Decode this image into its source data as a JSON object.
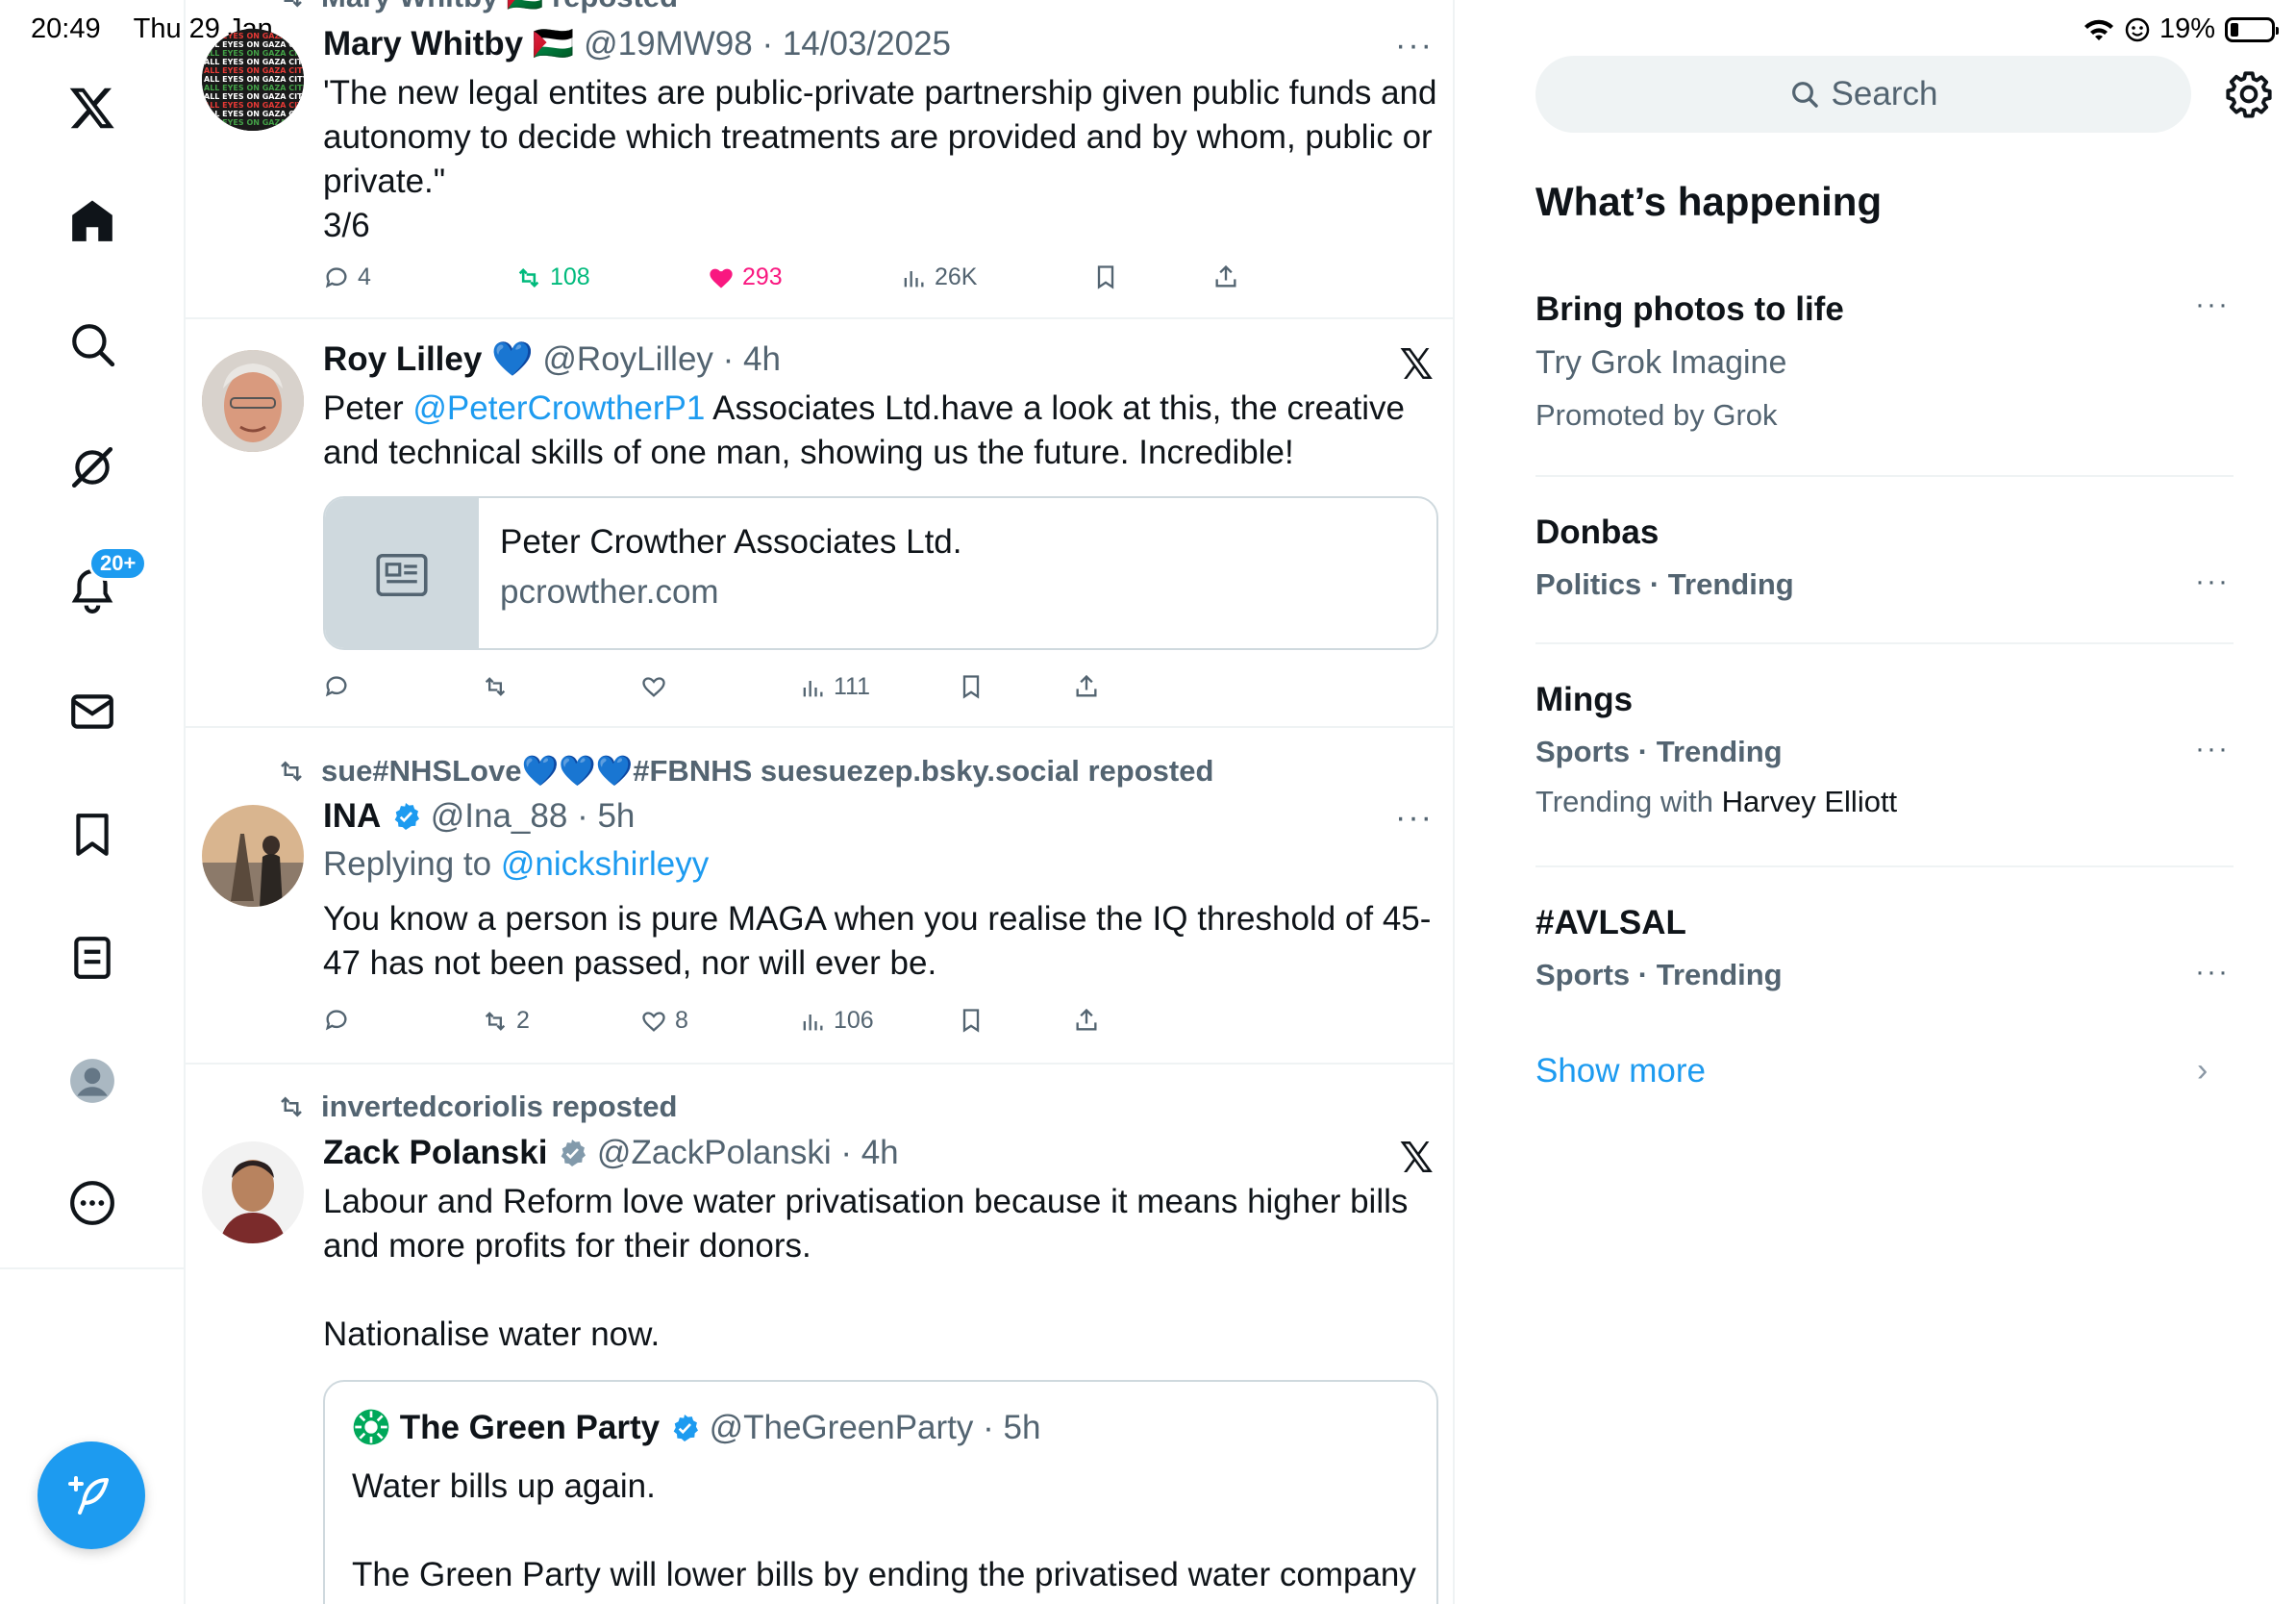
{
  "status_bar": {
    "time": "20:49",
    "date": "Thu 29 Jan",
    "battery": "19%",
    "battery_level": 0.19
  },
  "left_nav": {
    "items": [
      {
        "name": "x-logo"
      },
      {
        "name": "home"
      },
      {
        "name": "explore"
      },
      {
        "name": "grok"
      },
      {
        "name": "notifications",
        "badge": "20+"
      },
      {
        "name": "messages"
      },
      {
        "name": "bookmarks"
      },
      {
        "name": "lists"
      },
      {
        "name": "profile"
      },
      {
        "name": "more"
      }
    ],
    "compose_icon": "feather-plus-icon"
  },
  "feed": {
    "tweets": [
      {
        "repost_header": "Mary Whitby 🇵🇸 reposted",
        "name": "Mary Whitby",
        "flag": "🇵🇸",
        "handle": "@19MW98",
        "time": "14/03/2025",
        "text": "'The new legal entites are public-private partnership given public funds and autonomy to decide which treatments are provided and by whom, public or private.\"",
        "text2": "3/6",
        "replies": "4",
        "reposts": "108",
        "likes": "293",
        "views": "26K",
        "reposted": true,
        "liked": true,
        "avatar_text": "ALL EYES ON GAZA CITY"
      },
      {
        "name": "Roy Lilley",
        "badge_emoji": "💙",
        "handle": "@RoyLilley",
        "time": "4h",
        "text_pre": "Peter ",
        "mention": "@PeterCrowtherP1",
        "text_post": " Associates Ltd.have a look at this, the creative and technical skills of one man, showing us the future.  Incredible!",
        "card": {
          "title": "Peter Crowther Associates Ltd.",
          "domain": "pcrowther.com"
        },
        "views": "111"
      },
      {
        "repost_header": "sue#NHSLove💙💙💙#FBNHS suesuezep.bsky.social reposted",
        "name": "INA",
        "handle": "@Ina_88",
        "time": "5h",
        "replying_label": "Replying to ",
        "replying_to": "@nickshirleyy",
        "text": "You know a person is pure MAGA when you realise the IQ threshold of 45-47 has not been passed, nor will ever be.",
        "reposts": "2",
        "likes": "8",
        "views": "106"
      },
      {
        "repost_header": "invertedcoriolis reposted",
        "name": "Zack Polanski",
        "handle": "@ZackPolanski",
        "time": "4h",
        "text": "Labour and Reform love water privatisation because it means higher bills and more profits for their donors.",
        "text2": "Nationalise water now.",
        "quote": {
          "name": "The Green Party",
          "handle": "@TheGreenParty",
          "time": "5h",
          "text": "Water bills up again.",
          "text2": "The Green Party will lower bills by ending the privatised water company"
        }
      }
    ]
  },
  "sidebar": {
    "search_placeholder": "Search",
    "title": "What’s happening",
    "trends": [
      {
        "name": "Bring photos to life",
        "sub": "Try Grok Imagine",
        "meta": "Promoted by Grok"
      },
      {
        "name": "Donbas",
        "meta": "Politics · Trending"
      },
      {
        "name": "Mings",
        "meta": "Sports · Trending",
        "extra_prefix": "Trending with ",
        "extra_name": "Harvey Elliott"
      },
      {
        "name": "#AVLSAL",
        "meta": "Sports · Trending"
      }
    ],
    "show_more": "Show more"
  },
  "colors": {
    "accent": "#1d9bf0",
    "repost_green": "#00ba7c",
    "like_pink": "#f91880",
    "muted": "#536471",
    "border": "#eff3f4"
  }
}
